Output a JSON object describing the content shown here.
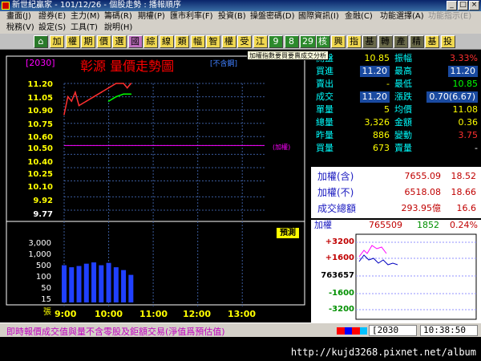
{
  "window": {
    "title": "新世紀贏家 - 101/12/26 - 個股走勢 : 播報順序",
    "buttons": [
      "_",
      "□",
      "×"
    ]
  },
  "menu": {
    "row1": [
      "畫面(J)",
      "證券(E)",
      "主力(M)",
      "籌碼(R)",
      "期權(P)",
      "匯市利率(F)",
      "投資(B)",
      "操盤密碼(D)",
      "國際資訊(I)",
      "金融(C)",
      "功能選擇(A)",
      "功能指示(E)"
    ],
    "row2": [
      "稅務(V)",
      "設定(S)",
      "工具(T)",
      "說明(H)"
    ]
  },
  "toolbar": {
    "buttons": [
      "加",
      "權",
      "期",
      "價",
      "選",
      "國",
      "綜",
      "線",
      "類",
      "幅",
      "智",
      "權",
      "受",
      "江",
      "9",
      "8",
      "29",
      "核",
      "興",
      "指",
      "基",
      "轉",
      "產",
      "精",
      "基",
      "投"
    ]
  },
  "tooltip": "加權指數要買要賣成交分析",
  "chart": {
    "code": "[2030]",
    "title": "彰源  量價走勢圖",
    "adj_tag": "[不含鋼]",
    "price_ticks": [
      "11.20",
      "11.05",
      "10.90",
      "10.75",
      "10.60",
      "10.50",
      "10.40",
      "10.25",
      "10.10",
      "9.92",
      "9.77"
    ],
    "vol_ticks": [
      "3,000",
      "1,000",
      "500",
      "100",
      "50",
      "15",
      "張"
    ],
    "time_ticks": [
      "9:00",
      "10:00",
      "11:00",
      "12:00",
      "13:00"
    ],
    "adj_small": "(加權)",
    "quote_button": "預測"
  },
  "chart_data": {
    "type": "line",
    "title": "彰源  量價走勢圖",
    "xlabel": "",
    "ylabel": "",
    "ylim": [
      9.77,
      11.2
    ],
    "series": [
      {
        "name": "成交",
        "x": [
          "9:00",
          "9:05",
          "9:10",
          "9:15",
          "9:20",
          "9:30",
          "9:40",
          "9:50",
          "10:00",
          "10:10",
          "10:20",
          "10:25",
          "10:30"
        ],
        "values": [
          10.85,
          11.05,
          11.0,
          11.1,
          10.95,
          11.0,
          11.05,
          11.1,
          11.15,
          11.2,
          11.2,
          11.15,
          11.2
        ]
      },
      {
        "name": "均價",
        "x": [
          "10:00",
          "10:10",
          "10:20",
          "10:30"
        ],
        "values": [
          11.0,
          11.05,
          11.08,
          11.08
        ]
      }
    ],
    "volume": {
      "name": "張",
      "x": [
        "9:00",
        "9:10",
        "9:20",
        "9:30",
        "9:40",
        "9:50",
        "10:00",
        "10:10",
        "10:20",
        "10:30"
      ],
      "values": [
        200,
        150,
        180,
        250,
        300,
        200,
        280,
        150,
        100,
        50
      ]
    }
  },
  "quote": {
    "rows": [
      {
        "l1": "開盤",
        "v1": "10.85",
        "l2": "振幅",
        "v2": "3.33%"
      },
      {
        "l1": "買進",
        "v1": "11.20",
        "l2": "最高",
        "v2": "11.20"
      },
      {
        "l1": "賣出",
        "v1": "-",
        "l2": "最低",
        "v2": "10.85"
      },
      {
        "l1": "成交",
        "v1": "11.20",
        "l2": "漲跌",
        "v2": "0.70(6.67)"
      },
      {
        "l1": "單量",
        "v1": "5",
        "l2": "均價",
        "v2": "11.08"
      },
      {
        "l1": "總量",
        "v1": "3,326",
        "l2": "金額",
        "v2": "0.36"
      },
      {
        "l1": "昨量",
        "v1": "886",
        "l2": "變動",
        "v2": "3.75"
      },
      {
        "l1": "買量",
        "v1": "673",
        "l2": "賣量",
        "v2": "-"
      }
    ],
    "colors": {
      "v1": [
        "#ffff00",
        "#ffffff",
        "#ffff00",
        "#ffffff",
        "#ffff00",
        "#ffff00",
        "#ffff00",
        "#ffff00"
      ],
      "v2": [
        "#ff3030",
        "#ffffff",
        "#00ff00",
        "#ffffff",
        "#ffff00",
        "#ffff00",
        "#ff3030",
        "#ffffff"
      ]
    }
  },
  "index": {
    "rows": [
      {
        "label": "加權(含)",
        "v1": "7655.09",
        "v2": "18.52"
      },
      {
        "label": "加權(不)",
        "v1": "6518.08",
        "v2": "18.66"
      },
      {
        "label": "成交總額",
        "v1": "293.95億",
        "v2": "16.6"
      }
    ]
  },
  "mini": {
    "label": "加權",
    "value": "765509",
    "change": "1852",
    "pct": "0.24%",
    "ticks": [
      "+3200",
      "+1600",
      "763657",
      "-1600",
      "-3200"
    ]
  },
  "status": {
    "text": "即時報價成交值與量不含零股及鉅額交易(淨值爲預估值)",
    "code_box": "[2030",
    "time": "10:38:50",
    "watermark": "http://kujd3268.pixnet.net/album"
  }
}
